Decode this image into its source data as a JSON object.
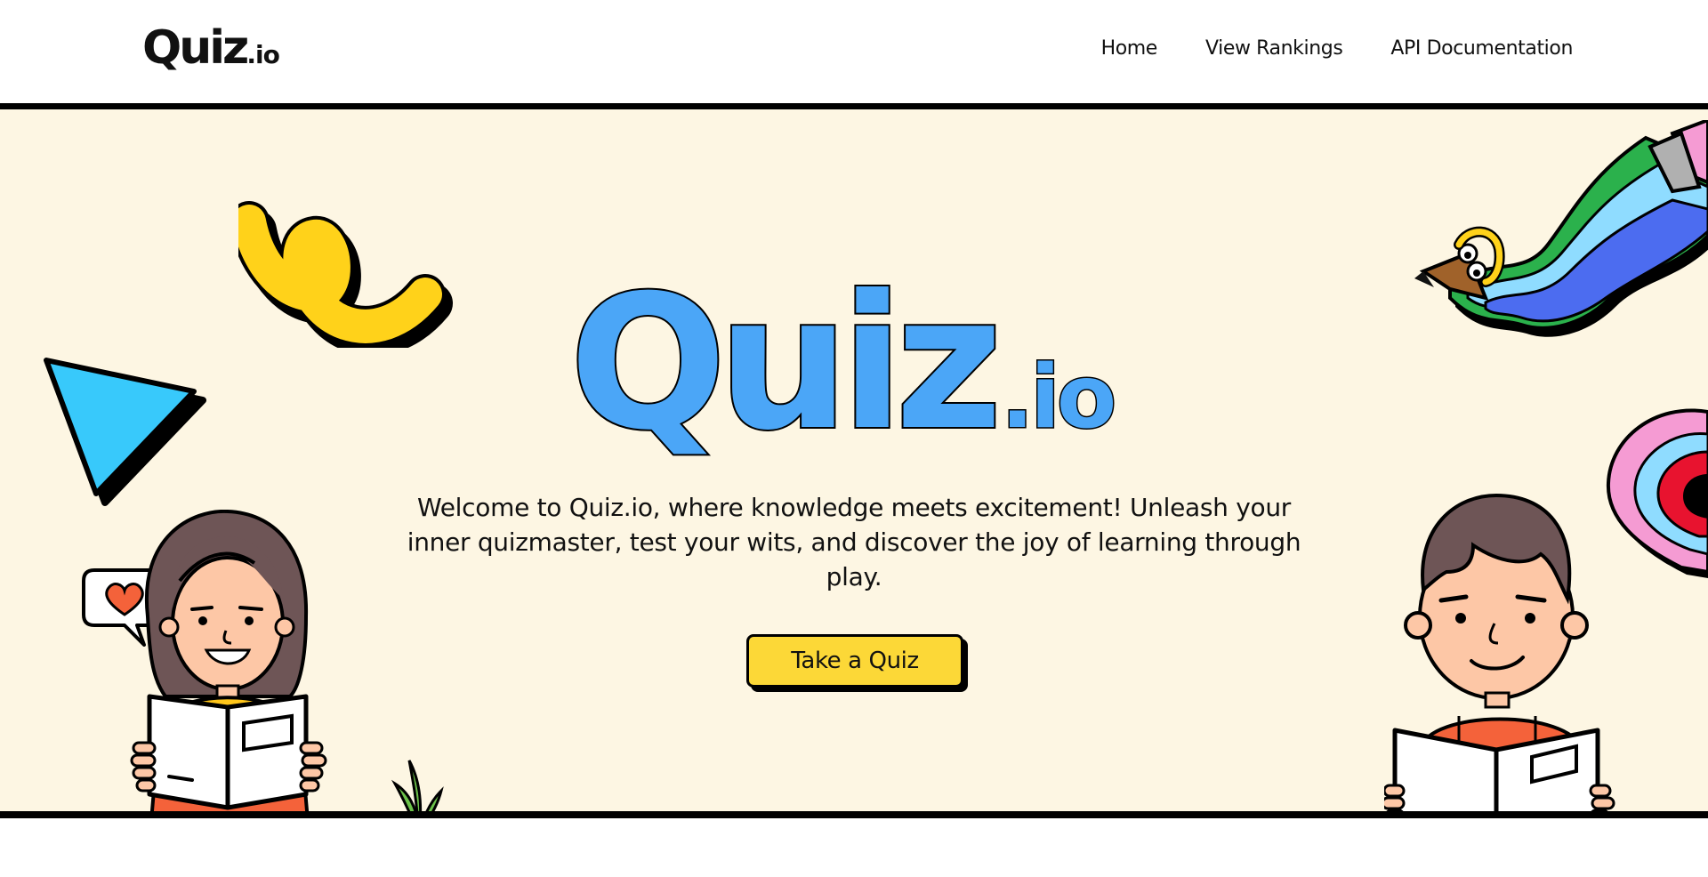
{
  "header": {
    "logo_main": "Quiz",
    "logo_suffix": ".io",
    "nav": [
      "Home",
      "View Rankings",
      "API Documentation"
    ]
  },
  "hero": {
    "big_logo_main": "Quiz",
    "big_logo_suffix": ".io",
    "welcome_text": "Welcome to Quiz.io, where knowledge meets excitement! Unleash your inner quizmaster, test your wits, and discover the joy of learning through play.",
    "cta_label": "Take a Quiz"
  },
  "colors": {
    "hero_background": "#fdf6e3",
    "big_logo_fill": "#4ba6f7",
    "cta_fill": "#fcd837",
    "triangle": "#38c9fb",
    "swirl": "#ffd21a",
    "heart": "#f4623a"
  },
  "icons": [
    "swirl-decoration-icon",
    "triangle-decoration-icon",
    "pencil-worm-decoration-icon",
    "rainbow-decoration-icon",
    "heart-speech-bubble-icon",
    "plant-icon"
  ]
}
